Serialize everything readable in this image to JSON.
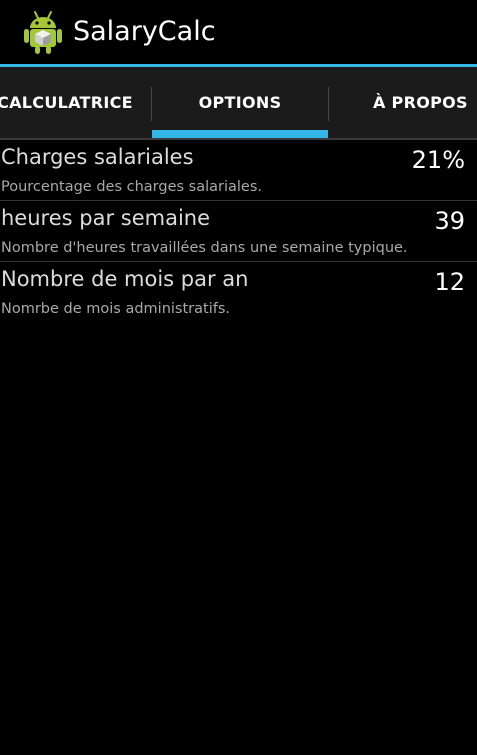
{
  "app": {
    "title": "SalaryCalc",
    "icon": "android-robot-icon"
  },
  "colors": {
    "accent": "#33b5e5",
    "background": "#000000",
    "tab_strip": "#1b1b1b"
  },
  "tabs": [
    {
      "label": "CALCULATRICE",
      "selected": false
    },
    {
      "label": "OPTIONS",
      "selected": true
    },
    {
      "label": "À PROPOS",
      "selected": false
    }
  ],
  "preferences": [
    {
      "title": "Charges salariales",
      "summary": "Pourcentage des charges salariales.",
      "value": "21%"
    },
    {
      "title": "heures par semaine",
      "summary": "Nombre d'heures travaillées dans une semaine typique.",
      "value": "39"
    },
    {
      "title": "Nombre de mois par an",
      "summary": "Nomrbe de mois administratifs.",
      "value": "12"
    }
  ]
}
